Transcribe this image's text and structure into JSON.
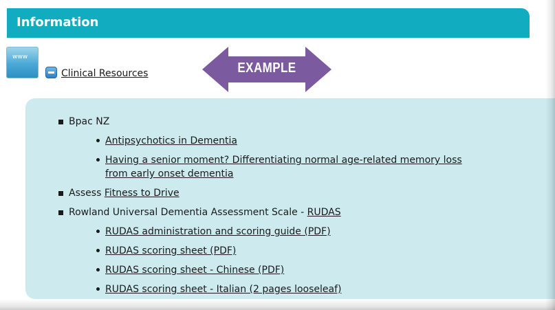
{
  "header": {
    "title": "Information"
  },
  "www_icon": {
    "label": "www"
  },
  "section": {
    "toggle_icon": "collapse-minus-icon",
    "link": "Clinical Resources"
  },
  "example": {
    "label": "EXAMPLE",
    "color": "#7c5aa0"
  },
  "colors": {
    "header_bg": "#12acc0",
    "content_bg": "#cdebef"
  },
  "items": {
    "bpac": "Bpac NZ",
    "bpac_sub": {
      "antipsychotics": "Antipsychotics in Dementia",
      "senior_moment_line1": "Having a senior moment? Differentiating normal age-related memory loss",
      "senior_moment_line2": "from early onset dementia"
    },
    "assess_prefix": "Assess",
    "fitness_link": "Fitness to Drive",
    "rowland_prefix": "Rowland Universal Dementia Assessment Scale -",
    "rudas_link": "RUDAS",
    "rudas_sub": {
      "guide": "RUDAS administration and scoring guide (PDF)",
      "sheet": "RUDAS scoring sheet (PDF)",
      "chinese": "RUDAS scoring sheet - Chinese (PDF)",
      "italian": "RUDAS scoring sheet - Italian (2 pages looseleaf)"
    }
  }
}
